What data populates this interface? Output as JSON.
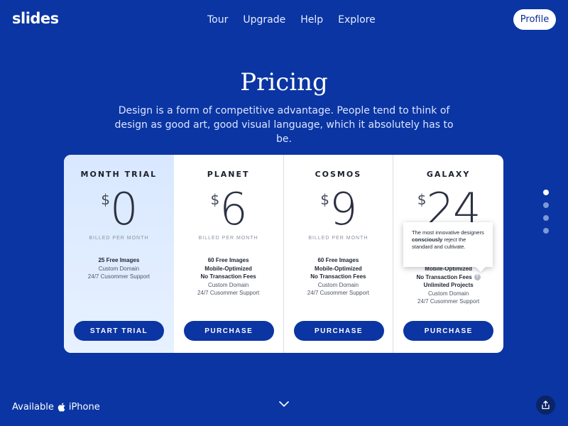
{
  "header": {
    "logo": "slides",
    "nav": [
      "Tour",
      "Upgrade",
      "Help",
      "Explore"
    ],
    "profile_label": "Profile"
  },
  "hero": {
    "title": "Pricing",
    "subtitle": "Design is a form of competitive advantage. People tend to think of design as good art, good visual language, which it absolutely has to be."
  },
  "plans": [
    {
      "name": "MONTH TRIAL",
      "currency": "$",
      "price": "0",
      "billed": "BILLED PER MONTH",
      "features": [
        {
          "text": "25 Free Images",
          "bold": true
        },
        {
          "text": "Custom Domain",
          "bold": false
        },
        {
          "text": "24/7 Cusommer Support",
          "bold": false
        }
      ],
      "button": "START TRIAL"
    },
    {
      "name": "PLANET",
      "currency": "$",
      "price": "6",
      "billed": "BILLED PER MONTH",
      "features": [
        {
          "text": "60 Free Images",
          "bold": true
        },
        {
          "text": "Mobile-Optimized",
          "bold": true
        },
        {
          "text": "No Transaction Fees",
          "bold": true
        },
        {
          "text": "Custom Domain",
          "bold": false
        },
        {
          "text": "24/7 Cusommer Support",
          "bold": false
        }
      ],
      "button": "PURCHASE"
    },
    {
      "name": "COSMOS",
      "currency": "$",
      "price": "9",
      "billed": "BILLED PER MONTH",
      "features": [
        {
          "text": "60 Free Images",
          "bold": true
        },
        {
          "text": "Mobile-Optimized",
          "bold": true
        },
        {
          "text": "No Transaction Fees",
          "bold": true
        },
        {
          "text": "Custom Domain",
          "bold": false
        },
        {
          "text": "24/7 Cusommer Support",
          "bold": false
        }
      ],
      "button": "PURCHASE"
    },
    {
      "name": "GALAXY",
      "currency": "$",
      "price": "24",
      "billed": "",
      "features": [
        {
          "text": "Mobile-Optimized",
          "bold": true
        },
        {
          "text": "No Transaction Fees",
          "bold": true
        },
        {
          "text": "Unlimited Projects",
          "bold": true
        },
        {
          "text": "Custom Domain",
          "bold": false
        },
        {
          "text": "24/7 Cusommer Support",
          "bold": false
        }
      ],
      "button": "PURCHASE"
    }
  ],
  "tooltip": {
    "before": "The most innovative designers ",
    "emph": "consciously",
    "after": " reject the standard and cultivate."
  },
  "help_icon": "?",
  "pager": {
    "count": 4,
    "active": 0
  },
  "footer": {
    "available_label": "Available",
    "platform": "iPhone",
    "platform_icon": "apple-icon",
    "scroll_icon": "chevron-down-icon",
    "share_icon": "share-icon"
  },
  "colors": {
    "background": "#0a35a3",
    "button": "#0a35a3",
    "trial_card": "#e2eeff"
  }
}
